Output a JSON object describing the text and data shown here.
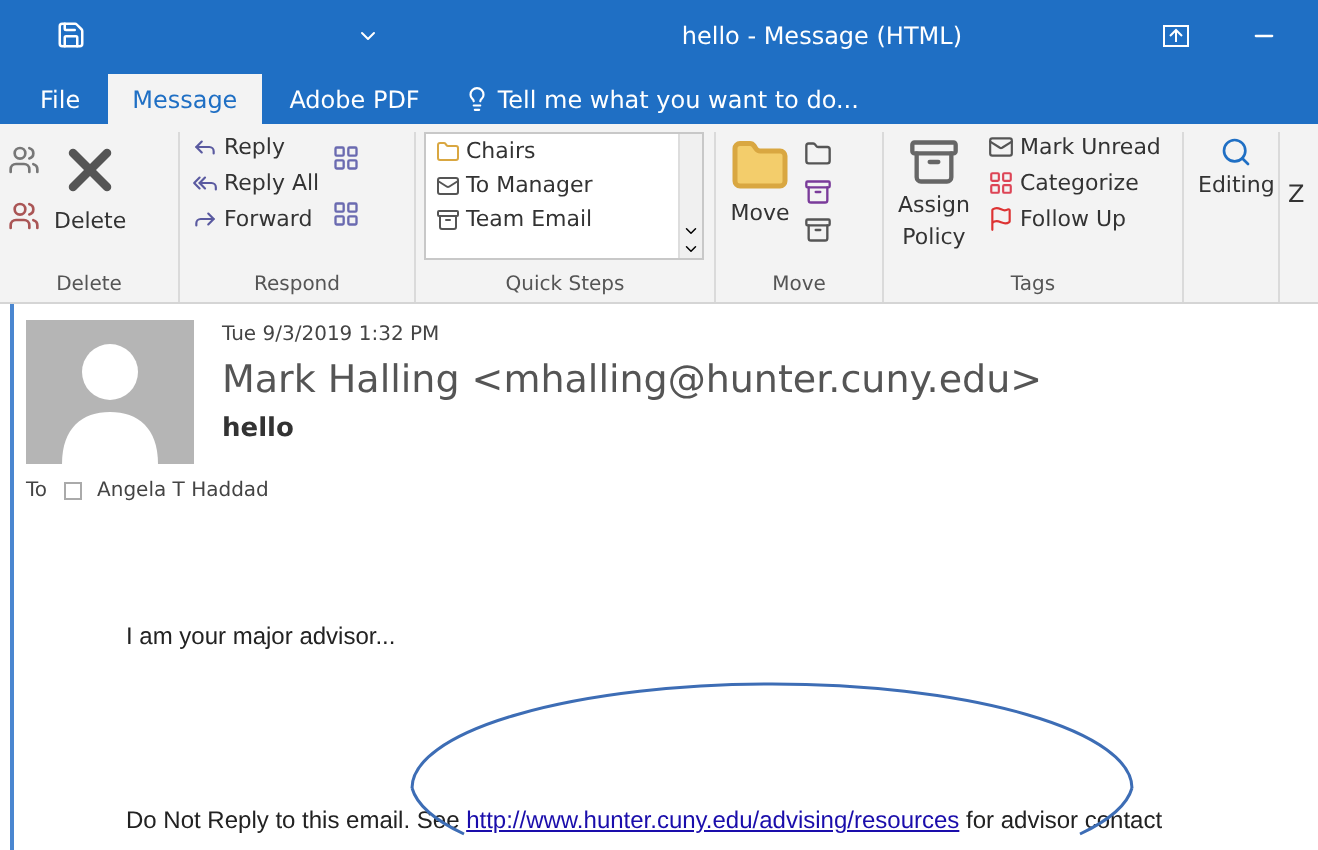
{
  "window": {
    "title": "hello - Message (HTML)"
  },
  "tabs": [
    {
      "label": "File",
      "selected": false
    },
    {
      "label": "Message",
      "selected": true
    },
    {
      "label": "Adobe PDF",
      "selected": false
    }
  ],
  "tell_me": {
    "placeholder": "Tell me what you want to do..."
  },
  "ribbon": {
    "delete": {
      "button": "Delete",
      "label": "Delete"
    },
    "respond": {
      "buttons": [
        "Reply",
        "Reply All",
        "Forward"
      ],
      "label": "Respond"
    },
    "quick_steps": {
      "items": [
        "Chairs",
        "To Manager",
        "Team Email"
      ],
      "label": "Quick Steps"
    },
    "move": {
      "button": "Move",
      "label": "Move"
    },
    "tags": {
      "assign_lines": [
        "Assign",
        "Policy"
      ],
      "buttons": [
        "Mark Unread",
        "Categorize",
        "Follow Up"
      ],
      "label": "Tags"
    },
    "editing": {
      "button": "Editing"
    },
    "column_cut": "Z"
  },
  "message": {
    "date": "Tue 9/3/2019 1:32 PM",
    "sender": "Mark Halling <mhalling@hunter.cuny.edu>",
    "subject": "hello",
    "to_label": "To",
    "recipient": "Angela T Haddad",
    "body": [
      {
        "text": "I am your major advisor..."
      },
      {
        "text": "Do Not Reply to this email. See ",
        "link": "http://www.hunter.cuny.edu/advising/resources",
        "after": " for advisor contact"
      }
    ]
  }
}
